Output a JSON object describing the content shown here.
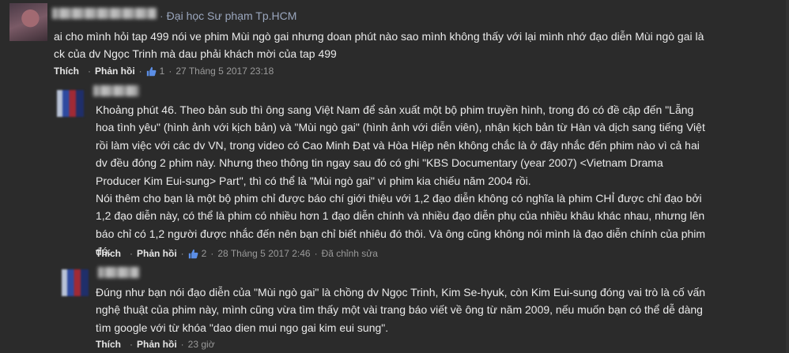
{
  "comments": [
    {
      "school": "Đại học Sư phạm Tp.HCM",
      "text_lines": [
        "ai cho mình hỏi tap 499 nói ve phim Mùi ngò gai nhưng doan phút nào sao mình không thấy với lại mình nhớ đạo diễn Mùi ngò gai là",
        "ck của dv Ngọc Trinh mà dau phải khách mời của tap 499"
      ],
      "like_label": "Thích",
      "reply_label": "Phản hồi",
      "like_count": "1",
      "timestamp": "27 Tháng 5 2017 23:18"
    },
    {
      "text_lines": [
        "Khoảng phút 46. Theo bản sub thì ông sang Việt Nam để sản xuất một bộ phim truyền hình, trong đó có đề cập đến \"Lẵng",
        "hoa tình yêu\" (hình ảnh với kịch bản) và \"Mùi ngò gai\" (hình ảnh với diễn viên), nhận kịch bản từ Hàn và dịch sang tiếng Việt",
        "rồi làm việc với các dv VN, trong video có Cao Minh Đạt và Hòa Hiệp nên không chắc là ở đây nhắc đến phim nào vì cả hai",
        "dv đều đóng 2 phim này. Nhưng theo thông tin ngay sau đó có ghi \"KBS Documentary (year 2007) <Vietnam Drama",
        "Producer Kim Eui-sung> Part\", thì có thể là \"Mùi ngò gai\" vì phim kia chiếu năm 2004 rồi.",
        "Nói thêm cho bạn là một bộ phim chỉ được báo chí giới thiệu với 1,2 đạo diễn không có nghĩa là phim CHỈ được chỉ đạo bởi",
        "1,2 đạo diễn này, có thể là phim có nhiều hơn 1 đạo diễn chính và nhiều đạo diễn phụ của nhiều khâu khác nhau, nhưng lên",
        "báo chỉ có 1,2 người được nhắc đến nên bạn chỉ biết nhiêu đó thôi. Và ông cũng không nói mình là đạo diễn chính của phim",
        "đó."
      ],
      "like_label": "Thích",
      "reply_label": "Phản hồi",
      "like_count": "2",
      "timestamp": "28 Tháng 5 2017 2:46",
      "edited_label": "Đã chỉnh sửa"
    },
    {
      "text_lines": [
        "Đúng như bạn nói đạo diễn của \"Mùi ngò gai\" là chồng dv Ngọc Trinh, Kim Se-hyuk, còn Kim Eui-sung đóng vai trò là cố vấn",
        "nghệ thuật của phim này, mình cũng vừa tìm thấy một vài trang báo viết về ông từ năm 2009, nếu muốn bạn có thể dễ dàng",
        "tìm google với từ khóa \"dao dien mui ngo gai kim eui sung\"."
      ],
      "like_label": "Thích",
      "reply_label": "Phản hồi",
      "timestamp": "23 giờ"
    }
  ],
  "colors": {
    "background": "#2b2b2b",
    "text": "#eaeaea",
    "muted": "#9a9a9a",
    "like_icon": "#5b8ee6"
  },
  "icons": {
    "like": "thumbs-up-icon"
  }
}
